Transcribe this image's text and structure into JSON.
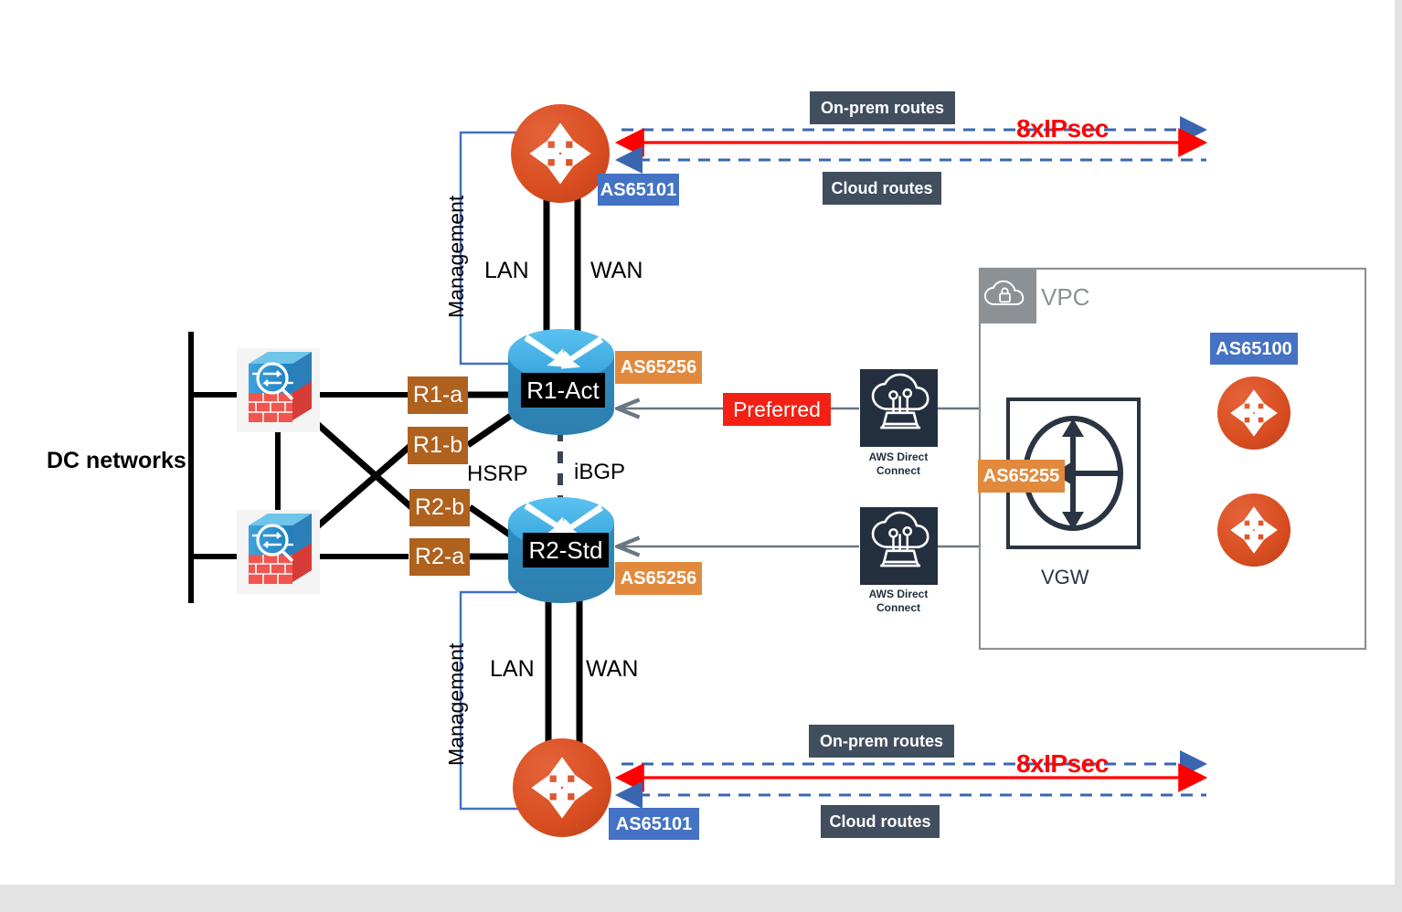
{
  "diagram": {
    "title": "Hybrid DC to AWS VPC BGP routing topology",
    "colors": {
      "router_orange": "#D94E21",
      "switch_blue": "#3FA9DE",
      "tag_brown": "#AF611E",
      "tag_orange": "#E18A3E",
      "tag_blue": "#4472C4",
      "tag_slate": "#404E5E",
      "tag_red": "#F32013",
      "ipsec_red": "#FF0000",
      "bgp_blue_dash": "#3A66B0",
      "aws_navy": "#232F3E",
      "vpc_gray": "#8C9196",
      "mgmt_line_blue": "#4472C4"
    }
  },
  "left": {
    "dc_networks_label": "DC networks",
    "firewalls": [
      {
        "name": "firewall-top"
      },
      {
        "name": "firewall-bottom"
      }
    ]
  },
  "interface_tags": [
    {
      "id": "r1a",
      "label": "R1-a"
    },
    {
      "id": "r1b",
      "label": "R1-b"
    },
    {
      "id": "r2b",
      "label": "R2-b"
    },
    {
      "id": "r2a",
      "label": "R2-a"
    }
  ],
  "core": {
    "hsrp_label": "HSRP",
    "ibgp_label": "iBGP",
    "switches": [
      {
        "id": "r1act",
        "name_label": "R1-Act",
        "as_label": "AS65256"
      },
      {
        "id": "r2std",
        "name_label": "R2-Std",
        "as_label": "AS65256"
      }
    ]
  },
  "edge_routers": [
    {
      "id": "top",
      "as_label": "AS65101",
      "management_label": "Management",
      "lan_label": "LAN",
      "wan_label": "WAN",
      "onprem_routes_label": "On-prem routes",
      "cloud_routes_label": "Cloud routes",
      "ipsec_label": "8xIPsec"
    },
    {
      "id": "bottom",
      "as_label": "AS65101",
      "management_label": "Management",
      "lan_label": "LAN",
      "wan_label": "WAN",
      "onprem_routes_label": "On-prem routes",
      "cloud_routes_label": "Cloud routes",
      "ipsec_label": "8xIPsec"
    }
  ],
  "links": {
    "preferred_label": "Preferred"
  },
  "aws": {
    "direct_connect": [
      {
        "id": "dx-top",
        "caption": "AWS Direct Connect"
      },
      {
        "id": "dx-bottom",
        "caption": "AWS Direct Connect"
      }
    ],
    "vpc": {
      "title": "VPC",
      "vgw": {
        "caption": "VGW",
        "as_label": "AS65255"
      },
      "cloud_routers_as_label": "AS65100",
      "cloud_routers": [
        {
          "id": "cloud-router-top"
        },
        {
          "id": "cloud-router-bottom"
        }
      ]
    }
  }
}
